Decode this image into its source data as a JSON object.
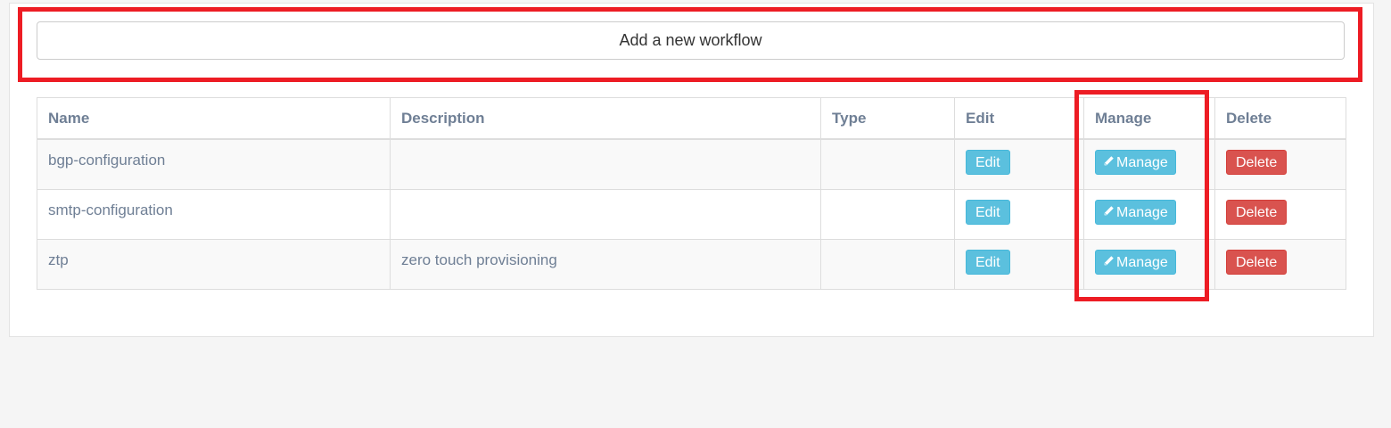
{
  "add_workflow_label": "Add a new workflow",
  "table": {
    "headers": [
      "Name",
      "Description",
      "Type",
      "Edit",
      "Manage",
      "Delete"
    ],
    "rows": [
      {
        "name": "bgp-configuration",
        "description": "",
        "type": ""
      },
      {
        "name": "smtp-configuration",
        "description": "",
        "type": ""
      },
      {
        "name": "ztp",
        "description": "zero touch provisioning",
        "type": ""
      }
    ],
    "edit_label": "Edit",
    "manage_label": "Manage",
    "delete_label": "Delete"
  },
  "colors": {
    "info": "#5bc0de",
    "danger": "#d9534f",
    "highlight": "#ed1c24"
  }
}
